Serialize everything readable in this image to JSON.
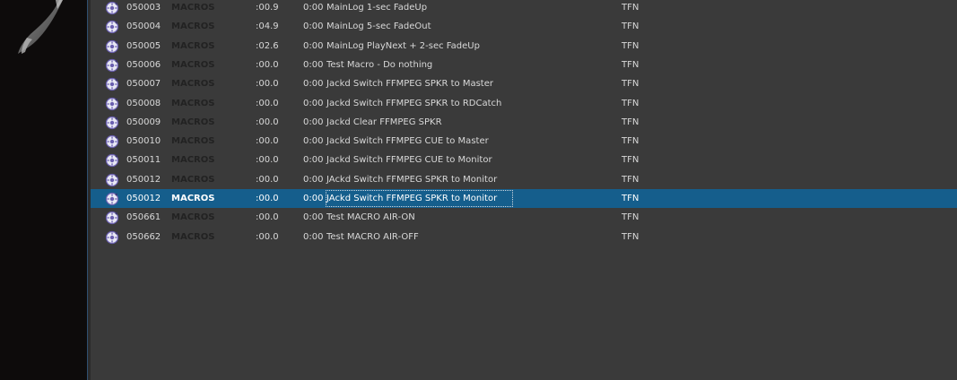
{
  "rows": [
    {
      "cart": "050003",
      "group": "MACROS",
      "length": ":00.9",
      "time": "0:00",
      "title": "MainLog 1-sec FadeUp",
      "owner": "TFN",
      "icon": "macro-cart-icon"
    },
    {
      "cart": "050004",
      "group": "MACROS",
      "length": ":04.9",
      "time": "0:00",
      "title": "MainLog 5-sec FadeOut",
      "owner": "TFN",
      "icon": "macro-cart-icon"
    },
    {
      "cart": "050005",
      "group": "MACROS",
      "length": ":02.6",
      "time": "0:00",
      "title": "MainLog PlayNext + 2-sec FadeUp",
      "owner": "TFN",
      "icon": "macro-cart-icon"
    },
    {
      "cart": "050006",
      "group": "MACROS",
      "length": ":00.0",
      "time": "0:00",
      "title": "Test Macro - Do nothing",
      "owner": "TFN",
      "icon": "macro-cart-icon"
    },
    {
      "cart": "050007",
      "group": "MACROS",
      "length": ":00.0",
      "time": "0:00",
      "title": "Jackd Switch FFMPEG SPKR to Master",
      "owner": "TFN",
      "icon": "macro-cart-icon"
    },
    {
      "cart": "050008",
      "group": "MACROS",
      "length": ":00.0",
      "time": "0:00",
      "title": "Jackd Switch FFMPEG SPKR to RDCatch",
      "owner": "TFN",
      "icon": "macro-cart-icon"
    },
    {
      "cart": "050009",
      "group": "MACROS",
      "length": ":00.0",
      "time": "0:00",
      "title": "Jackd Clear FFMPEG SPKR",
      "owner": "TFN",
      "icon": "macro-cart-icon"
    },
    {
      "cart": "050010",
      "group": "MACROS",
      "length": ":00.0",
      "time": "0:00",
      "title": "Jackd Switch FFMPEG CUE to Master",
      "owner": "TFN",
      "icon": "macro-cart-icon"
    },
    {
      "cart": "050011",
      "group": "MACROS",
      "length": ":00.0",
      "time": "0:00",
      "title": "Jackd Switch FFMPEG CUE to Monitor",
      "owner": "TFN",
      "icon": "macro-cart-icon"
    },
    {
      "cart": "050012",
      "group": "MACROS",
      "length": ":00.0",
      "time": "0:00",
      "title": "JAckd Switch FFMPEG SPKR to Monitor",
      "owner": "TFN",
      "icon": "macro-cart-icon"
    },
    {
      "cart": "050012",
      "group": "MACROS",
      "length": ":00.0",
      "time": "0:00",
      "title": "JAckd Switch FFMPEG SPKR to Monitor",
      "owner": "TFN",
      "icon": "macro-cart-icon",
      "selected": true
    },
    {
      "cart": "050661",
      "group": "MACROS",
      "length": ":00.0",
      "time": "0:00",
      "title": "Test MACRO AIR-ON",
      "owner": "TFN",
      "icon": "macro-cart-icon"
    },
    {
      "cart": "050662",
      "group": "MACROS",
      "length": ":00.0",
      "time": "0:00",
      "title": "Test MACRO AIR-OFF",
      "owner": "TFN",
      "icon": "macro-cart-icon"
    }
  ],
  "colors": {
    "background": "#3a3a3a",
    "selection": "#155e8c",
    "group_text": "#222222",
    "row_text": "#d8d8d8"
  }
}
